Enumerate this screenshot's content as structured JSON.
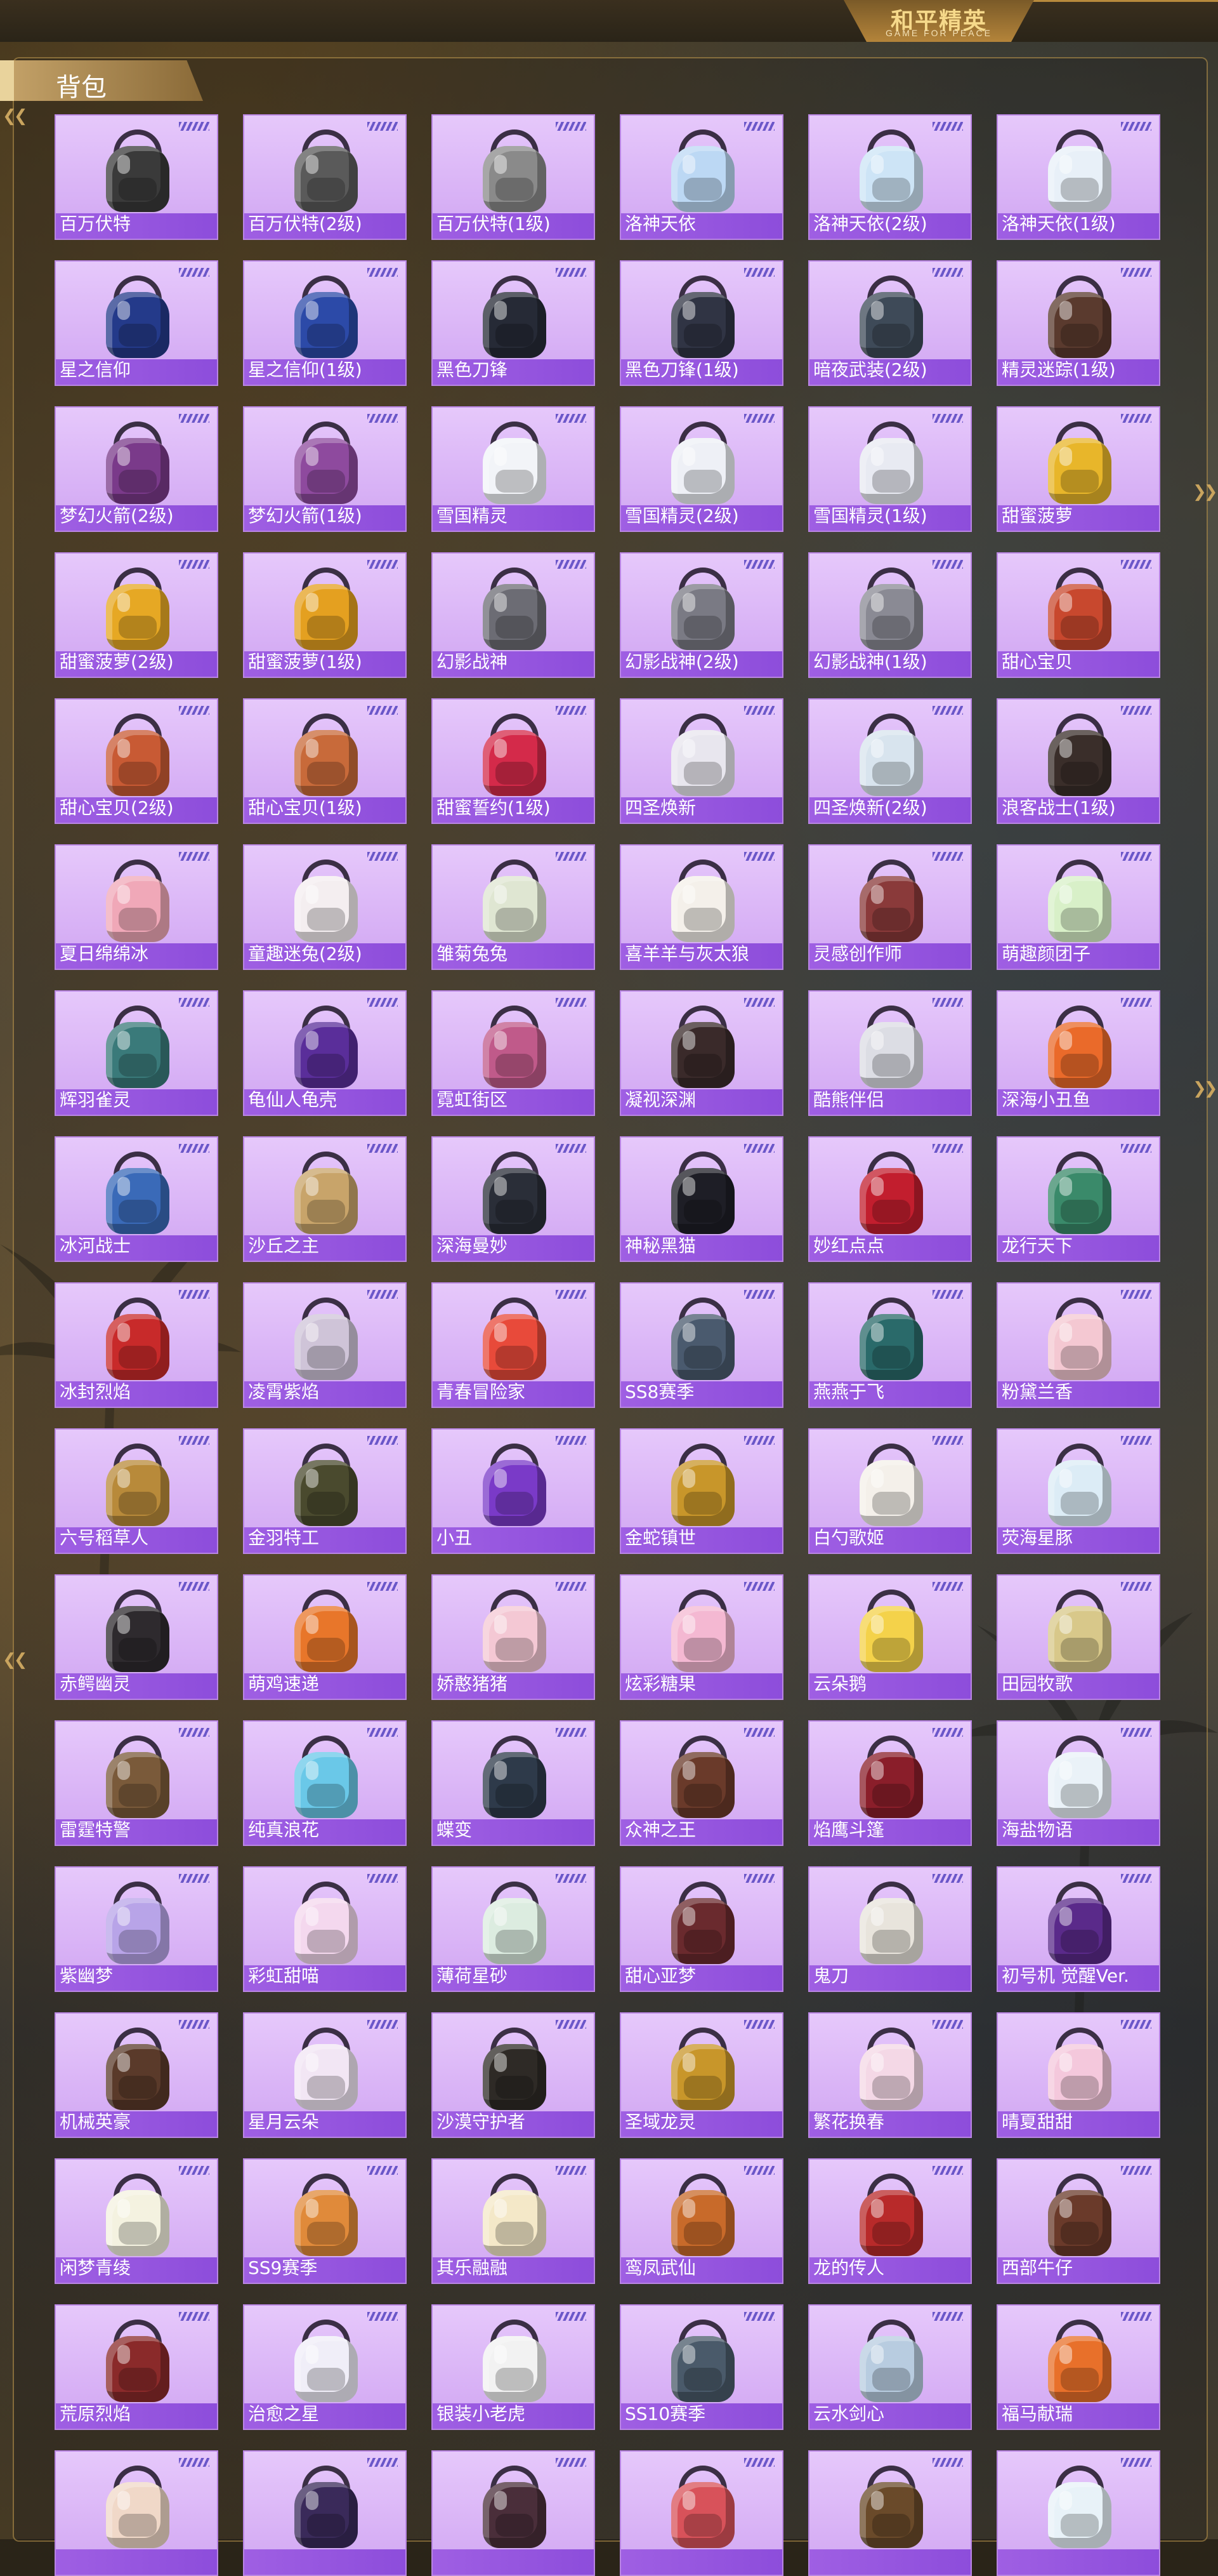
{
  "header": {
    "logo_title": "和平精英",
    "logo_subtitle": "GAME FOR PEACE"
  },
  "panel": {
    "title": "背包"
  },
  "colors": {
    "card_bg": "#e2c2fa",
    "card_border": "#b985e3",
    "label_bar": "#9a58e2",
    "rank_stripes": "#6b57c9",
    "title_plate": "#c6a46a"
  },
  "backpacks": [
    {
      "name": "百万伏特",
      "color": "#3a3a3a"
    },
    {
      "name": "百万伏特(2级)",
      "color": "#5a5a5a"
    },
    {
      "name": "百万伏特(1级)",
      "color": "#8a8a8a"
    },
    {
      "name": "洛神天依",
      "color": "#bcd8f4"
    },
    {
      "name": "洛神天依(2级)",
      "color": "#cde4f6"
    },
    {
      "name": "洛神天依(1级)",
      "color": "#e8f0f8"
    },
    {
      "name": "星之信仰",
      "color": "#243a8a"
    },
    {
      "name": "星之信仰(1级)",
      "color": "#2c4aa8"
    },
    {
      "name": "黑色刀锋",
      "color": "#262a36"
    },
    {
      "name": "黑色刀锋(1级)",
      "color": "#303444"
    },
    {
      "name": "暗夜武装(2级)",
      "color": "#3e4a58"
    },
    {
      "name": "精灵迷踪(1级)",
      "color": "#5a3a2e"
    },
    {
      "name": "梦幻火箭(2级)",
      "color": "#7a3a8a"
    },
    {
      "name": "梦幻火箭(1级)",
      "color": "#8e4a9e"
    },
    {
      "name": "雪国精灵",
      "color": "#f2f4f8"
    },
    {
      "name": "雪国精灵(2级)",
      "color": "#eef0f6"
    },
    {
      "name": "雪国精灵(1级)",
      "color": "#e8eaf2"
    },
    {
      "name": "甜蜜菠萝",
      "color": "#e8b62a"
    },
    {
      "name": "甜蜜菠萝(2级)",
      "color": "#e6a824"
    },
    {
      "name": "甜蜜菠萝(1级)",
      "color": "#e4a020"
    },
    {
      "name": "幻影战神",
      "color": "#6c6c74"
    },
    {
      "name": "幻影战神(2级)",
      "color": "#7a7a84"
    },
    {
      "name": "幻影战神(1级)",
      "color": "#8a8a94"
    },
    {
      "name": "甜心宝贝",
      "color": "#c8482e"
    },
    {
      "name": "甜心宝贝(2级)",
      "color": "#c85a34"
    },
    {
      "name": "甜心宝贝(1级)",
      "color": "#c86a3a"
    },
    {
      "name": "甜蜜誓约(1级)",
      "color": "#d42a4a"
    },
    {
      "name": "四圣焕新",
      "color": "#e8e6ee"
    },
    {
      "name": "四圣焕新(2级)",
      "color": "#d8e4ee"
    },
    {
      "name": "浪客战士(1级)",
      "color": "#3a2e2a"
    },
    {
      "name": "夏日绵绵冰",
      "color": "#f0a8b8"
    },
    {
      "name": "童趣迷兔(2级)",
      "color": "#f4eef0"
    },
    {
      "name": "雏菊兔兔",
      "color": "#dfe6d2"
    },
    {
      "name": "喜羊羊与灰太狼",
      "color": "#f4f0ea"
    },
    {
      "name": "灵感创作师",
      "color": "#8a3a3a"
    },
    {
      "name": "萌趣颜团子",
      "color": "#d8f0c8"
    },
    {
      "name": "辉羽雀灵",
      "color": "#3a7a7a"
    },
    {
      "name": "龟仙人龟壳",
      "color": "#5a2e9a"
    },
    {
      "name": "霓虹街区",
      "color": "#c05a8a"
    },
    {
      "name": "凝视深渊",
      "color": "#3a2a2a"
    },
    {
      "name": "酷熊伴侣",
      "color": "#dcdde4"
    },
    {
      "name": "深海小丑鱼",
      "color": "#ea6a2a"
    },
    {
      "name": "冰河战士",
      "color": "#3a6ab8"
    },
    {
      "name": "沙丘之主",
      "color": "#c8a46a"
    },
    {
      "name": "深海曼妙",
      "color": "#2a2e38"
    },
    {
      "name": "神秘黑猫",
      "color": "#1e1e26"
    },
    {
      "name": "妙红点点",
      "color": "#c21e2e"
    },
    {
      "name": "龙行天下",
      "color": "#3a8a6a"
    },
    {
      "name": "冰封烈焰",
      "color": "#c82a2a"
    },
    {
      "name": "凌霄紫焰",
      "color": "#cfc4d8"
    },
    {
      "name": "青春冒险家",
      "color": "#e84a3a"
    },
    {
      "name": "SS8赛季",
      "color": "#4a5a6e"
    },
    {
      "name": "燕燕于飞",
      "color": "#2a6a6a"
    },
    {
      "name": "粉黛兰香",
      "color": "#f4c8d2"
    },
    {
      "name": "六号稻草人",
      "color": "#b88a3a"
    },
    {
      "name": "金羽特工",
      "color": "#4a4a2e"
    },
    {
      "name": "小丑",
      "color": "#7a3ac8"
    },
    {
      "name": "金蛇镇世",
      "color": "#c8962a"
    },
    {
      "name": "白勺歌姬",
      "color": "#f4f0ea"
    },
    {
      "name": "荧海星豚",
      "color": "#dcecf6"
    },
    {
      "name": "赤鳄幽灵",
      "color": "#2e2a2e"
    },
    {
      "name": "萌鸡速递",
      "color": "#e8762a"
    },
    {
      "name": "娇憨猪猪",
      "color": "#f4c8d4"
    },
    {
      "name": "炫彩糖果",
      "color": "#f4b8d2"
    },
    {
      "name": "云朵鹅",
      "color": "#f4d24a"
    },
    {
      "name": "田园牧歌",
      "color": "#d8c88a"
    },
    {
      "name": "雷霆特警",
      "color": "#7a5a3a"
    },
    {
      "name": "纯真浪花",
      "color": "#6ac8e8"
    },
    {
      "name": "蝶变",
      "color": "#2e3a4a"
    },
    {
      "name": "众神之王",
      "color": "#6a3a2a"
    },
    {
      "name": "焰鹰斗篷",
      "color": "#8a1e2a"
    },
    {
      "name": "海盐物语",
      "color": "#eaf2f8"
    },
    {
      "name": "紫幽梦",
      "color": "#b8a4e8"
    },
    {
      "name": "彩虹甜喵",
      "color": "#f4d8ee"
    },
    {
      "name": "薄荷星砂",
      "color": "#dcece0"
    },
    {
      "name": "甜心亚梦",
      "color": "#6a2a2e"
    },
    {
      "name": "鬼刀",
      "color": "#e8e4dc"
    },
    {
      "name": "初号机 觉醒Ver.",
      "color": "#5a2a8a"
    },
    {
      "name": "机械英豪",
      "color": "#5a3a2a"
    },
    {
      "name": "星月云朵",
      "color": "#f2e6f4"
    },
    {
      "name": "沙漠守护者",
      "color": "#2e2a26"
    },
    {
      "name": "圣域龙灵",
      "color": "#c8962a"
    },
    {
      "name": "繁花换春",
      "color": "#f4d8e6"
    },
    {
      "name": "晴夏甜甜",
      "color": "#f4c8dc"
    },
    {
      "name": "闲梦青绫",
      "color": "#f4f2e0"
    },
    {
      "name": "SS9赛季",
      "color": "#e08a3a"
    },
    {
      "name": "其乐融融",
      "color": "#f4e8c8"
    },
    {
      "name": "鸾凤武仙",
      "color": "#c86a2a"
    },
    {
      "name": "龙的传人",
      "color": "#b82a2a"
    },
    {
      "name": "西部牛仔",
      "color": "#6a3a2a"
    },
    {
      "name": "荒原烈焰",
      "color": "#8a2a2a"
    },
    {
      "name": "治愈之星",
      "color": "#f0eef8"
    },
    {
      "name": "银装小老虎",
      "color": "#f2f2f2"
    },
    {
      "name": "SS10赛季",
      "color": "#4a5a6a"
    },
    {
      "name": "云水剑心",
      "color": "#b8cce0"
    },
    {
      "name": "福马献瑞",
      "color": "#e8702a"
    },
    {
      "name": "",
      "color": "#f0d8c8"
    },
    {
      "name": "",
      "color": "#3a2a5a"
    },
    {
      "name": "",
      "color": "#4a2e3a"
    },
    {
      "name": "",
      "color": "#d8525a"
    },
    {
      "name": "",
      "color": "#6a4a2a"
    },
    {
      "name": "",
      "color": "#e8f2f8"
    }
  ]
}
